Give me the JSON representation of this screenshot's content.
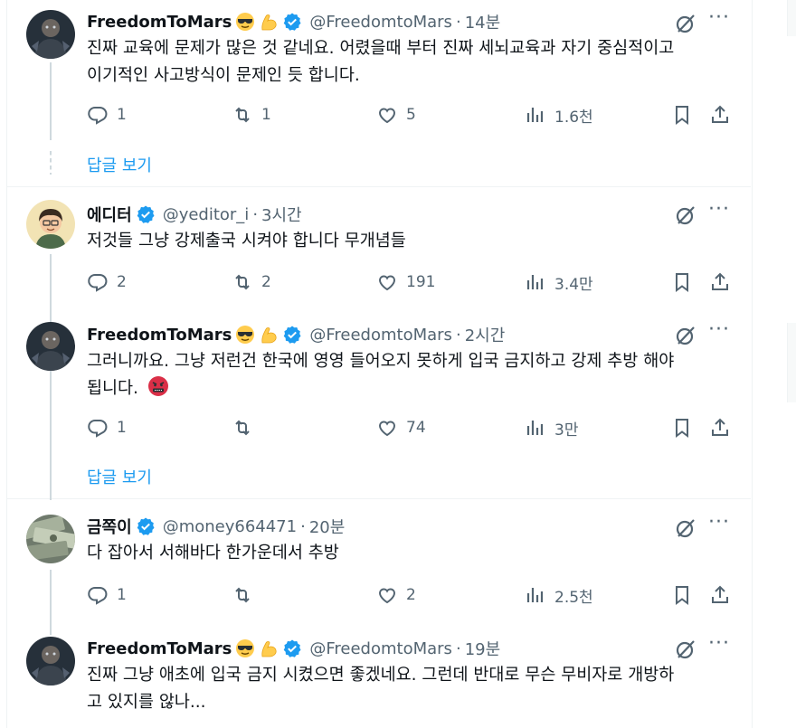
{
  "tweets": [
    {
      "name": "FreedomToMars",
      "handle": "@FreedomtoMars",
      "time": "14분",
      "text_lines": [
        "진짜 교육에 문제가 많은 것 같네요. 어렸을때 부터 진짜 세뇌교육과 자기 중심적이고",
        "이기적인 사고방식이 문제인 듯 합니다."
      ],
      "emoji": [
        "smiling-face-with-sunglasses",
        "flexed-biceps"
      ],
      "replies": "1",
      "reposts": "1",
      "likes": "5",
      "views": "1.6천",
      "show_replies": "답글 보기"
    },
    {
      "name": "에디터",
      "handle": "@yeditor_i",
      "time": "3시간",
      "text_lines": [
        "저것들 그냥 강제출국 시켜야 합니다 무개념들"
      ],
      "emoji": [],
      "replies": "2",
      "reposts": "2",
      "likes": "191",
      "views": "3.4만"
    },
    {
      "name": "FreedomToMars",
      "handle": "@FreedomtoMars",
      "time": "2시간",
      "text_lines": [
        "그러니까요. 그냥 저런건 한국에 영영 들어오지 못하게 입국 금지하고 강제 추방 해야",
        "됩니다."
      ],
      "inline_emoji": "face-with-symbols-on-mouth",
      "emoji": [
        "smiling-face-with-sunglasses",
        "flexed-biceps"
      ],
      "replies": "1",
      "reposts": "",
      "likes": "74",
      "views": "3만",
      "show_replies": "답글 보기"
    },
    {
      "name": "금쪽이",
      "handle": "@money664471",
      "time": "20분",
      "text_lines": [
        "다 잡아서 서해바다 한가운데서 추방"
      ],
      "emoji": [],
      "replies": "1",
      "reposts": "",
      "likes": "2",
      "views": "2.5천"
    },
    {
      "name": "FreedomToMars",
      "handle": "@FreedomtoMars",
      "time": "19분",
      "text_lines": [
        "진짜 그냥 애초에 입국 금지 시켰으면 좋겠네요. 그런데 반대로 무슨 무비자로 개방하",
        "고 있지를 않나..."
      ],
      "emoji": [
        "smiling-face-with-sunglasses",
        "flexed-biceps"
      ]
    }
  ],
  "dot_separator": "·",
  "icons": {
    "reply": "reply-icon",
    "repost": "repost-icon",
    "like": "like-icon",
    "views": "views-icon",
    "bookmark": "bookmark-icon",
    "share": "share-icon",
    "grok": "grok-icon",
    "more": "more-icon",
    "verified": "verified-badge-icon"
  },
  "colors": {
    "accent": "#1d9bf0",
    "muted": "#536471",
    "text": "#0f1419",
    "border": "#eff3f4"
  }
}
